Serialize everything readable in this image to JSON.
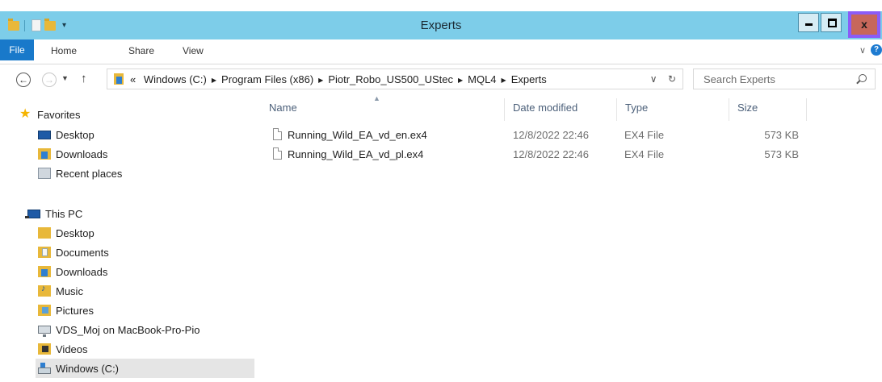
{
  "window": {
    "title": "Experts",
    "controls": {
      "minimize_icon": "minimize-icon",
      "maximize_icon": "maximize-icon",
      "close_label": "x"
    }
  },
  "ribbon": {
    "tabs": [
      {
        "label": "File",
        "active": true
      },
      {
        "label": "Home"
      },
      {
        "label": "Share"
      },
      {
        "label": "View"
      }
    ],
    "collapse_icon": "chevron-down-icon",
    "help_label": "?"
  },
  "address": {
    "prefix": "«",
    "crumbs": [
      "Windows (C:)",
      "Program Files (x86)",
      "Piotr_Robo_US500_UStec",
      "MQL4",
      "Experts"
    ],
    "dropdown_glyph": "∨",
    "refresh_glyph": "↻"
  },
  "search": {
    "placeholder": "Search Experts"
  },
  "nav": {
    "favorites": {
      "label": "Favorites",
      "items": [
        "Desktop",
        "Downloads",
        "Recent places"
      ]
    },
    "this_pc": {
      "label": "This PC",
      "items": [
        "Desktop",
        "Documents",
        "Downloads",
        "Music",
        "Pictures",
        "VDS_Moj on MacBook-Pro-Pio",
        "Videos",
        "Windows (C:)"
      ]
    }
  },
  "filelist": {
    "columns": [
      "Name",
      "Date modified",
      "Type",
      "Size"
    ],
    "rows": [
      {
        "name": "Running_Wild_EA_vd_en.ex4",
        "date": "12/8/2022 22:46",
        "type": "EX4 File",
        "size": "573 KB"
      },
      {
        "name": "Running_Wild_EA_vd_pl.ex4",
        "date": "12/8/2022 22:46",
        "type": "EX4 File",
        "size": "573 KB"
      }
    ]
  },
  "colors": {
    "titlebar": "#7dcde9",
    "file_tab": "#1979ca",
    "close_button": "#c7675a",
    "highlight_border": "#8b5cf6"
  }
}
